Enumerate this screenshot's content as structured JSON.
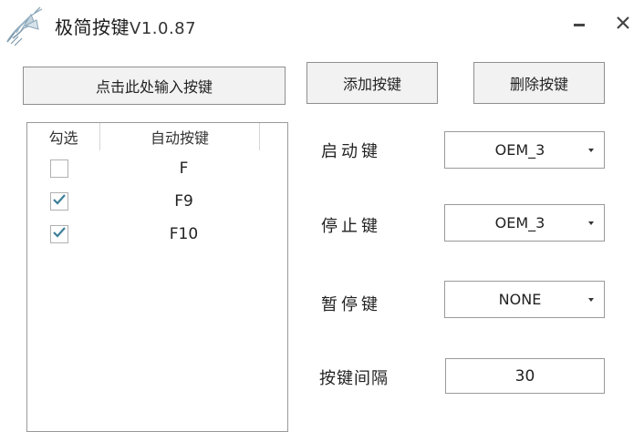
{
  "window": {
    "title": "极简按键",
    "version": "V1.0.87"
  },
  "toolbar": {
    "input_key_label": "点击此处输入按键",
    "add_key_label": "添加按键",
    "delete_key_label": "删除按键"
  },
  "key_list": {
    "header_check": "勾选",
    "header_key": "自动按键",
    "rows": [
      {
        "key": "F",
        "checked": false
      },
      {
        "key": "F9",
        "checked": true
      },
      {
        "key": "F10",
        "checked": true
      }
    ]
  },
  "settings": {
    "start_key": {
      "label": "启动键",
      "value": "OEM_3"
    },
    "stop_key": {
      "label": "停止键",
      "value": "OEM_3"
    },
    "pause_key": {
      "label": "暂停键",
      "value": "NONE"
    },
    "interval": {
      "label": "按键间隔",
      "value": "30"
    }
  },
  "colors": {
    "check_mark": "#3d7f9a",
    "logo": "#8aa6b8",
    "button_bg": "#f2f2f2",
    "border": "#9a9a9a"
  },
  "icons": {
    "logo": "mosquito-logo-icon",
    "minimize": "minimize-icon",
    "close": "close-icon",
    "dropdown": "caret-down-icon",
    "check": "check-icon"
  }
}
